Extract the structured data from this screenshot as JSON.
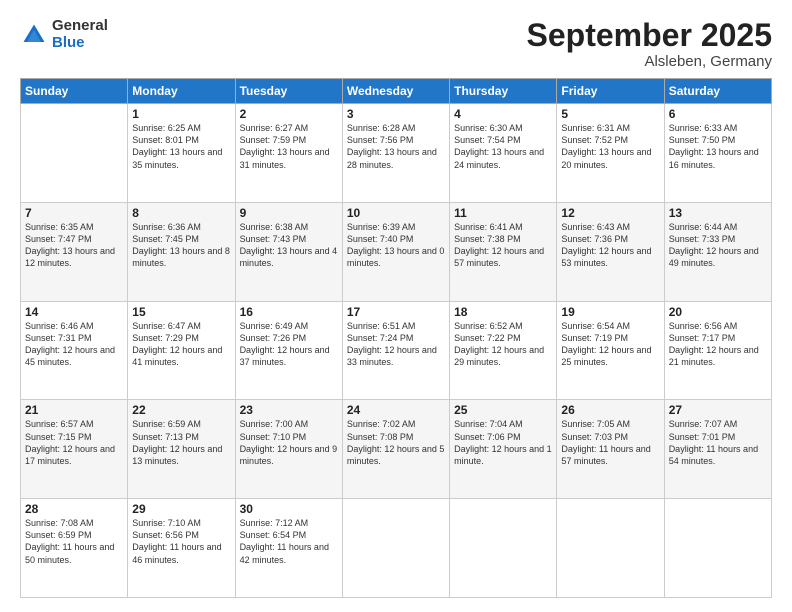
{
  "logo": {
    "general": "General",
    "blue": "Blue"
  },
  "title": "September 2025",
  "location": "Alsleben, Germany",
  "weekdays": [
    "Sunday",
    "Monday",
    "Tuesday",
    "Wednesday",
    "Thursday",
    "Friday",
    "Saturday"
  ],
  "weeks": [
    [
      {
        "day": "",
        "sunrise": "",
        "sunset": "",
        "daylight": ""
      },
      {
        "day": "1",
        "sunrise": "Sunrise: 6:25 AM",
        "sunset": "Sunset: 8:01 PM",
        "daylight": "Daylight: 13 hours and 35 minutes."
      },
      {
        "day": "2",
        "sunrise": "Sunrise: 6:27 AM",
        "sunset": "Sunset: 7:59 PM",
        "daylight": "Daylight: 13 hours and 31 minutes."
      },
      {
        "day": "3",
        "sunrise": "Sunrise: 6:28 AM",
        "sunset": "Sunset: 7:56 PM",
        "daylight": "Daylight: 13 hours and 28 minutes."
      },
      {
        "day": "4",
        "sunrise": "Sunrise: 6:30 AM",
        "sunset": "Sunset: 7:54 PM",
        "daylight": "Daylight: 13 hours and 24 minutes."
      },
      {
        "day": "5",
        "sunrise": "Sunrise: 6:31 AM",
        "sunset": "Sunset: 7:52 PM",
        "daylight": "Daylight: 13 hours and 20 minutes."
      },
      {
        "day": "6",
        "sunrise": "Sunrise: 6:33 AM",
        "sunset": "Sunset: 7:50 PM",
        "daylight": "Daylight: 13 hours and 16 minutes."
      }
    ],
    [
      {
        "day": "7",
        "sunrise": "Sunrise: 6:35 AM",
        "sunset": "Sunset: 7:47 PM",
        "daylight": "Daylight: 13 hours and 12 minutes."
      },
      {
        "day": "8",
        "sunrise": "Sunrise: 6:36 AM",
        "sunset": "Sunset: 7:45 PM",
        "daylight": "Daylight: 13 hours and 8 minutes."
      },
      {
        "day": "9",
        "sunrise": "Sunrise: 6:38 AM",
        "sunset": "Sunset: 7:43 PM",
        "daylight": "Daylight: 13 hours and 4 minutes."
      },
      {
        "day": "10",
        "sunrise": "Sunrise: 6:39 AM",
        "sunset": "Sunset: 7:40 PM",
        "daylight": "Daylight: 13 hours and 0 minutes."
      },
      {
        "day": "11",
        "sunrise": "Sunrise: 6:41 AM",
        "sunset": "Sunset: 7:38 PM",
        "daylight": "Daylight: 12 hours and 57 minutes."
      },
      {
        "day": "12",
        "sunrise": "Sunrise: 6:43 AM",
        "sunset": "Sunset: 7:36 PM",
        "daylight": "Daylight: 12 hours and 53 minutes."
      },
      {
        "day": "13",
        "sunrise": "Sunrise: 6:44 AM",
        "sunset": "Sunset: 7:33 PM",
        "daylight": "Daylight: 12 hours and 49 minutes."
      }
    ],
    [
      {
        "day": "14",
        "sunrise": "Sunrise: 6:46 AM",
        "sunset": "Sunset: 7:31 PM",
        "daylight": "Daylight: 12 hours and 45 minutes."
      },
      {
        "day": "15",
        "sunrise": "Sunrise: 6:47 AM",
        "sunset": "Sunset: 7:29 PM",
        "daylight": "Daylight: 12 hours and 41 minutes."
      },
      {
        "day": "16",
        "sunrise": "Sunrise: 6:49 AM",
        "sunset": "Sunset: 7:26 PM",
        "daylight": "Daylight: 12 hours and 37 minutes."
      },
      {
        "day": "17",
        "sunrise": "Sunrise: 6:51 AM",
        "sunset": "Sunset: 7:24 PM",
        "daylight": "Daylight: 12 hours and 33 minutes."
      },
      {
        "day": "18",
        "sunrise": "Sunrise: 6:52 AM",
        "sunset": "Sunset: 7:22 PM",
        "daylight": "Daylight: 12 hours and 29 minutes."
      },
      {
        "day": "19",
        "sunrise": "Sunrise: 6:54 AM",
        "sunset": "Sunset: 7:19 PM",
        "daylight": "Daylight: 12 hours and 25 minutes."
      },
      {
        "day": "20",
        "sunrise": "Sunrise: 6:56 AM",
        "sunset": "Sunset: 7:17 PM",
        "daylight": "Daylight: 12 hours and 21 minutes."
      }
    ],
    [
      {
        "day": "21",
        "sunrise": "Sunrise: 6:57 AM",
        "sunset": "Sunset: 7:15 PM",
        "daylight": "Daylight: 12 hours and 17 minutes."
      },
      {
        "day": "22",
        "sunrise": "Sunrise: 6:59 AM",
        "sunset": "Sunset: 7:13 PM",
        "daylight": "Daylight: 12 hours and 13 minutes."
      },
      {
        "day": "23",
        "sunrise": "Sunrise: 7:00 AM",
        "sunset": "Sunset: 7:10 PM",
        "daylight": "Daylight: 12 hours and 9 minutes."
      },
      {
        "day": "24",
        "sunrise": "Sunrise: 7:02 AM",
        "sunset": "Sunset: 7:08 PM",
        "daylight": "Daylight: 12 hours and 5 minutes."
      },
      {
        "day": "25",
        "sunrise": "Sunrise: 7:04 AM",
        "sunset": "Sunset: 7:06 PM",
        "daylight": "Daylight: 12 hours and 1 minute."
      },
      {
        "day": "26",
        "sunrise": "Sunrise: 7:05 AM",
        "sunset": "Sunset: 7:03 PM",
        "daylight": "Daylight: 11 hours and 57 minutes."
      },
      {
        "day": "27",
        "sunrise": "Sunrise: 7:07 AM",
        "sunset": "Sunset: 7:01 PM",
        "daylight": "Daylight: 11 hours and 54 minutes."
      }
    ],
    [
      {
        "day": "28",
        "sunrise": "Sunrise: 7:08 AM",
        "sunset": "Sunset: 6:59 PM",
        "daylight": "Daylight: 11 hours and 50 minutes."
      },
      {
        "day": "29",
        "sunrise": "Sunrise: 7:10 AM",
        "sunset": "Sunset: 6:56 PM",
        "daylight": "Daylight: 11 hours and 46 minutes."
      },
      {
        "day": "30",
        "sunrise": "Sunrise: 7:12 AM",
        "sunset": "Sunset: 6:54 PM",
        "daylight": "Daylight: 11 hours and 42 minutes."
      },
      {
        "day": "",
        "sunrise": "",
        "sunset": "",
        "daylight": ""
      },
      {
        "day": "",
        "sunrise": "",
        "sunset": "",
        "daylight": ""
      },
      {
        "day": "",
        "sunrise": "",
        "sunset": "",
        "daylight": ""
      },
      {
        "day": "",
        "sunrise": "",
        "sunset": "",
        "daylight": ""
      }
    ]
  ]
}
